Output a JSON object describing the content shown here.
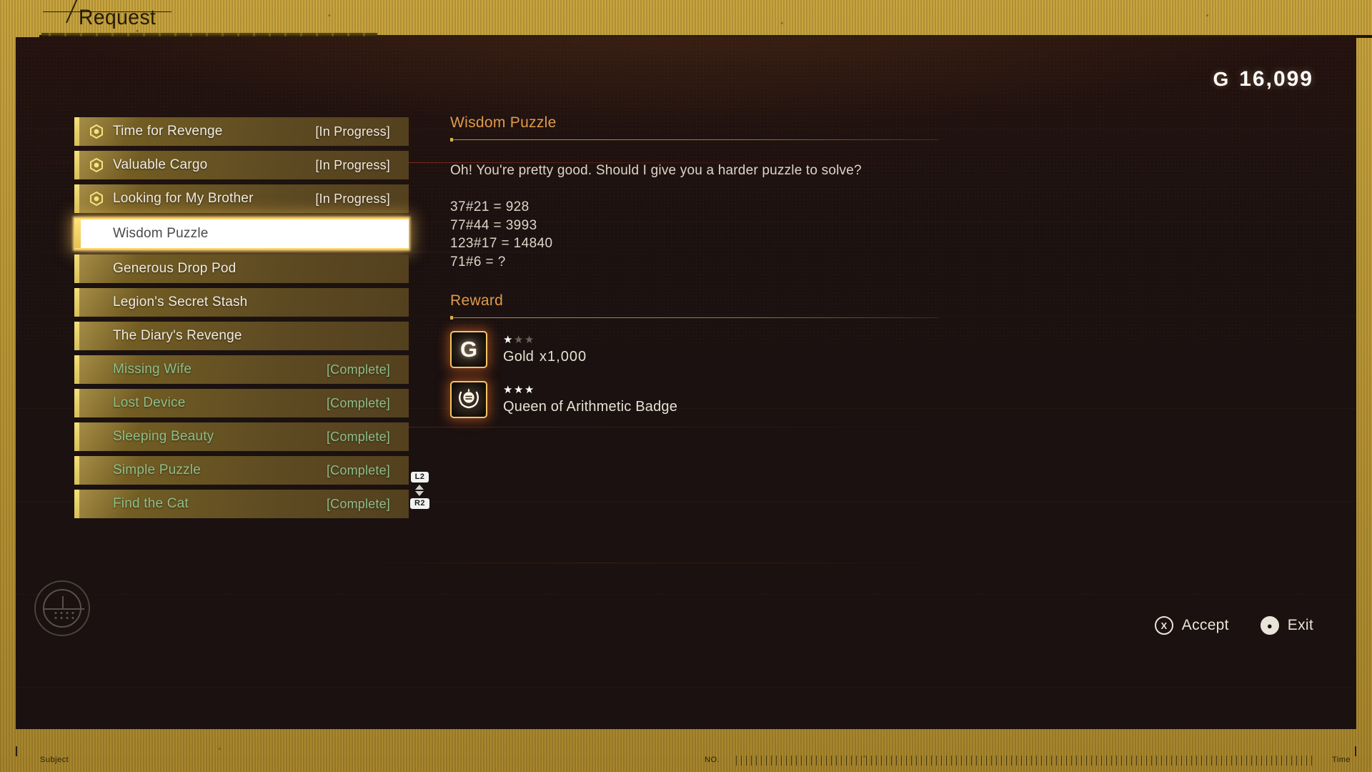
{
  "header": {
    "title": "Request"
  },
  "currency": {
    "symbol": "G",
    "amount": "16,099"
  },
  "quests": [
    {
      "label": "Time for Revenge",
      "status": "[In Progress]",
      "state": "in-progress",
      "icon": "hex-target-icon",
      "selected": false,
      "new": false
    },
    {
      "label": "Valuable Cargo",
      "status": "[In Progress]",
      "state": "in-progress",
      "icon": "hex-target-icon",
      "selected": false,
      "new": false
    },
    {
      "label": "Looking for My Brother",
      "status": "[In Progress]",
      "state": "in-progress",
      "icon": "hex-target-icon",
      "selected": false,
      "new": false
    },
    {
      "label": "Wisdom Puzzle",
      "status": "",
      "state": "available",
      "icon": "",
      "selected": true,
      "new": false
    },
    {
      "label": "Generous Drop Pod",
      "status": "",
      "state": "available",
      "icon": "",
      "selected": false,
      "new": false
    },
    {
      "label": "Legion's Secret Stash",
      "status": "",
      "state": "available",
      "icon": "",
      "selected": false,
      "new": false
    },
    {
      "label": "The Diary's Revenge",
      "status": "",
      "state": "available",
      "icon": "",
      "selected": false,
      "new": true
    },
    {
      "label": "Missing Wife",
      "status": "[Complete]",
      "state": "complete",
      "icon": "",
      "selected": false,
      "new": false
    },
    {
      "label": "Lost Device",
      "status": "[Complete]",
      "state": "complete",
      "icon": "",
      "selected": false,
      "new": false
    },
    {
      "label": "Sleeping Beauty",
      "status": "[Complete]",
      "state": "complete",
      "icon": "",
      "selected": false,
      "new": false
    },
    {
      "label": "Simple Puzzle",
      "status": "[Complete]",
      "state": "complete",
      "icon": "",
      "selected": false,
      "new": false
    },
    {
      "label": "Find the Cat",
      "status": "[Complete]",
      "state": "complete",
      "icon": "",
      "selected": false,
      "new": false
    }
  ],
  "scroll_hint": {
    "up_button": "L2",
    "down_button": "R2"
  },
  "detail": {
    "title": "Wisdom Puzzle",
    "description": "Oh! You're pretty good. Should I give you a harder puzzle to solve?",
    "puzzle_lines": [
      "37#21 = 928",
      "77#44 = 3993",
      "123#17 = 14840",
      "71#6 = ?"
    ],
    "reward_heading": "Reward",
    "rewards": [
      {
        "icon": "gold-coin-icon",
        "glyph": "G",
        "name": "Gold",
        "qty": "x1,000",
        "stars_filled": 1,
        "stars_total": 3
      },
      {
        "icon": "badge-laurel-icon",
        "glyph": "",
        "name": "Queen of Arithmetic Badge",
        "qty": "",
        "stars_filled": 3,
        "stars_total": 3
      }
    ]
  },
  "footer": {
    "accept": {
      "label": "Accept",
      "button": "X"
    },
    "exit": {
      "label": "Exit",
      "button": "O"
    }
  },
  "bottom_strip": {
    "subject": "Subject",
    "no": "NO.",
    "time": "Time"
  },
  "colors": {
    "frame_gold": "#bd9a37",
    "panel_bg": "#1a1110",
    "accent_orange": "#e09a4a",
    "row_gold": "#7e6524",
    "complete_green": "#8fbf8a",
    "selected_white": "#ffffff",
    "new_dot_red": "#e8594a"
  }
}
